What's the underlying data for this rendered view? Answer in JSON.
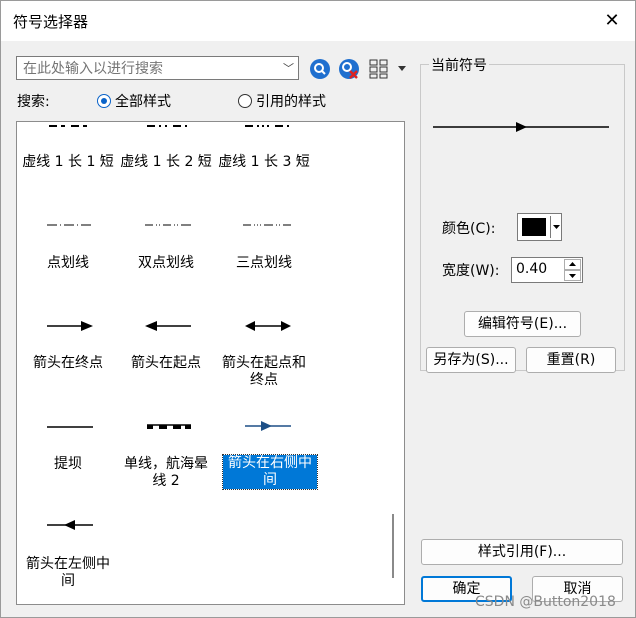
{
  "window": {
    "title": "符号选择器",
    "close_glyph": "✕"
  },
  "search": {
    "placeholder": "在此处输入以进行搜索",
    "label": "搜索:"
  },
  "scope": {
    "all_label": "全部样式",
    "referenced_label": "引用的样式",
    "selected": "all"
  },
  "symbols": [
    {
      "label": "虚线 1 长 1 短"
    },
    {
      "label": "虚线 1 长 2 短"
    },
    {
      "label": "虚线 1 长 3 短"
    },
    {
      "label": "点划线"
    },
    {
      "label": "双点划线"
    },
    {
      "label": "三点划线"
    },
    {
      "label": "箭头在终点"
    },
    {
      "label": "箭头在起点"
    },
    {
      "label": "箭头在起点和终点"
    },
    {
      "label": "提坝"
    },
    {
      "label": "单线，航海晕线 2"
    },
    {
      "label": "箭头在右侧中间",
      "selected": true
    },
    {
      "label": "箭头在左侧中间"
    }
  ],
  "current_symbol": {
    "group_label": "当前符号",
    "color_label": "颜色(C):",
    "color_value": "#000000",
    "width_label": "宽度(W):",
    "width_value": "0.40",
    "edit_button": "编辑符号(E)...",
    "save_as_button": "另存为(S)...",
    "reset_button": "重置(R)"
  },
  "footer": {
    "style_references_button": "样式引用(F)...",
    "ok_button": "确定",
    "cancel_button": "取消"
  },
  "watermark": "CSDN @Button2018",
  "colors": {
    "accent": "#0078d7",
    "selection": "#0078d7",
    "search_icon": "#1f6fcf",
    "clear_icon": "#d22"
  }
}
